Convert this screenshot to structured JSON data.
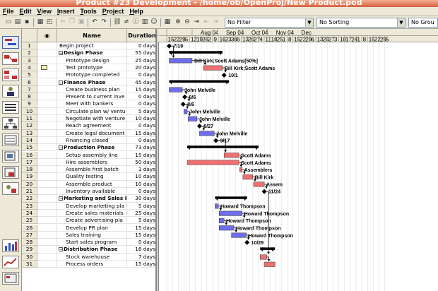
{
  "window": {
    "title": "Product #23 Development - /home/ob/OpenProj/New Product.pod"
  },
  "menu": [
    {
      "u": "F",
      "rest": "ile"
    },
    {
      "u": "E",
      "rest": "dit"
    },
    {
      "u": "V",
      "rest": "iew"
    },
    {
      "u": "I",
      "rest": "nsert"
    },
    {
      "u": "T",
      "rest": "ools"
    },
    {
      "u": "P",
      "rest": "roject"
    },
    {
      "u": "H",
      "rest": "elp"
    }
  ],
  "toolbar": {
    "filter": "No Filter",
    "sorting": "No Sorting",
    "grouping": "No Grou",
    "combo_arrow": "▼"
  },
  "grid": {
    "headers": {
      "info": "◉",
      "name": "Name",
      "duration": "Duration"
    },
    "expanded_marker": "−",
    "rows": [
      {
        "id": "1",
        "name": "Begin project",
        "dur": "0 days",
        "lvl": 1,
        "sum": false
      },
      {
        "id": "2",
        "name": "Design Phase",
        "dur": "55 days",
        "lvl": 0,
        "sum": true
      },
      {
        "id": "3",
        "name": "Prototype design",
        "dur": "25 days",
        "lvl": 2,
        "sum": false
      },
      {
        "id": "4",
        "name": "Test prototype",
        "dur": "20 days",
        "lvl": 2,
        "sum": false,
        "note": true
      },
      {
        "id": "5",
        "name": "Prototype completed",
        "dur": "0 days",
        "lvl": 2,
        "sum": false
      },
      {
        "id": "6",
        "name": "Finance Phase",
        "dur": "45 days",
        "lvl": 0,
        "sum": true
      },
      {
        "id": "7",
        "name": "Create business plan",
        "dur": "15 days",
        "lvl": 2,
        "sum": false
      },
      {
        "id": "8",
        "name": "Present to current inve",
        "dur": "0 days",
        "lvl": 2,
        "sum": false
      },
      {
        "id": "9",
        "name": "Meet with bankers",
        "dur": "0 days",
        "lvl": 2,
        "sum": false
      },
      {
        "id": "10",
        "name": "Circulate plan w/ ventu",
        "dur": "5 days",
        "lvl": 2,
        "sum": false
      },
      {
        "id": "11",
        "name": "Negotiate with venture",
        "dur": "10 days",
        "lvl": 2,
        "sum": false
      },
      {
        "id": "12",
        "name": "Reach agreement",
        "dur": "0 days",
        "lvl": 2,
        "sum": false
      },
      {
        "id": "13",
        "name": "Create legal document",
        "dur": "15 days",
        "lvl": 2,
        "sum": false
      },
      {
        "id": "14",
        "name": "Financing closed",
        "dur": "0 days",
        "lvl": 2,
        "sum": false
      },
      {
        "id": "15",
        "name": "Production Phase",
        "dur": "73 days",
        "lvl": 0,
        "sum": true
      },
      {
        "id": "16",
        "name": "Setup assembly line",
        "dur": "15 days",
        "lvl": 2,
        "sum": false
      },
      {
        "id": "17",
        "name": "Hire assemblers",
        "dur": "50 days",
        "lvl": 2,
        "sum": false
      },
      {
        "id": "18",
        "name": "Assemble first batch",
        "dur": "3 days",
        "lvl": 2,
        "sum": false
      },
      {
        "id": "19",
        "name": "Quality testing",
        "dur": "10 days",
        "lvl": 2,
        "sum": false
      },
      {
        "id": "20",
        "name": "Assemble product",
        "dur": "10 days",
        "lvl": 2,
        "sum": false
      },
      {
        "id": "21",
        "name": "Inventory available",
        "dur": "0 days",
        "lvl": 2,
        "sum": false
      },
      {
        "id": "22",
        "name": "Marketing and Sales P",
        "dur": "30 days",
        "lvl": 0,
        "sum": true
      },
      {
        "id": "23",
        "name": "Develop marketing pla",
        "dur": "5 days",
        "lvl": 2,
        "sum": false
      },
      {
        "id": "24",
        "name": "Create sales materials",
        "dur": "25 days",
        "lvl": 2,
        "sum": false
      },
      {
        "id": "25",
        "name": "Create advertising pla",
        "dur": "5 days",
        "lvl": 2,
        "sum": false
      },
      {
        "id": "26",
        "name": "Develop PR plan",
        "dur": "15 days",
        "lvl": 2,
        "sum": false
      },
      {
        "id": "27",
        "name": "Sales training",
        "dur": "15 days",
        "lvl": 2,
        "sum": false
      },
      {
        "id": "28",
        "name": "Start sales program",
        "dur": "0 days",
        "lvl": 2,
        "sum": false
      },
      {
        "id": "29",
        "name": "Distribution Phase",
        "dur": "16 days",
        "lvl": 0,
        "sum": true
      },
      {
        "id": "30",
        "name": "Stock warehouse",
        "dur": "7 days",
        "lvl": 2,
        "sum": false
      },
      {
        "id": "31",
        "name": "Process orders",
        "dur": "15 days",
        "lvl": 2,
        "sum": false
      }
    ]
  },
  "gantt": {
    "months": [
      "Aug 04",
      "Sep 04",
      "Oct 04",
      "Nov 04",
      "Dec"
    ],
    "days": [
      "15",
      "22",
      "29",
      "5",
      "12",
      "19",
      "26",
      "2",
      "9",
      "16",
      "23",
      "30",
      "6",
      "13",
      "20",
      "27",
      "4",
      "11",
      "18",
      "25",
      "1",
      "8",
      "15",
      "22",
      "29",
      "6",
      "13",
      "20",
      "27",
      "3",
      "10",
      "17",
      "24",
      "1",
      "8",
      "15",
      "22",
      "29",
      "5"
    ],
    "colors": {
      "summary": "#000000",
      "task": "#6e6eee",
      "critical": "#ee7070",
      "link": "#000000",
      "gridline": "#d8d8d8"
    },
    "bars": [
      {
        "row": 1,
        "type": "milestone",
        "day": 3,
        "label": "7/19"
      },
      {
        "row": 2,
        "type": "summary",
        "start": 3,
        "end": 68
      },
      {
        "row": 3,
        "type": "task",
        "start": 3,
        "end": 31,
        "label": "Bill Kirk;Scott Adams[50%]"
      },
      {
        "row": 4,
        "type": "critical",
        "start": 45,
        "end": 68,
        "label": "Bill Kirk;Scott Adams"
      },
      {
        "row": 5,
        "type": "milestone",
        "day": 70,
        "label": "10/1"
      },
      {
        "row": 6,
        "type": "summary",
        "start": 3,
        "end": 76
      },
      {
        "row": 7,
        "type": "task",
        "start": 3,
        "end": 19,
        "label": "John Melville"
      },
      {
        "row": 8,
        "type": "milestone",
        "day": 22,
        "label": "8/6"
      },
      {
        "row": 9,
        "type": "milestone",
        "day": 20,
        "label": "8/6"
      },
      {
        "row": 10,
        "type": "task",
        "start": 21,
        "end": 25,
        "label": "John Melville"
      },
      {
        "row": 11,
        "type": "task",
        "start": 26,
        "end": 37,
        "label": "John Melville"
      },
      {
        "row": 12,
        "type": "milestone",
        "day": 40,
        "label": "8/27"
      },
      {
        "row": 13,
        "type": "task",
        "start": 40,
        "end": 58,
        "label": "John Melville"
      },
      {
        "row": 14,
        "type": "milestone",
        "day": 60,
        "label": "9/17"
      },
      {
        "row": 15,
        "type": "summary",
        "start": 25,
        "end": 112
      },
      {
        "row": 16,
        "type": "critical",
        "start": 70,
        "end": 88,
        "label": "Scott Adams"
      },
      {
        "row": 17,
        "type": "critical",
        "start": 25,
        "end": 88,
        "label": "Scott Adams"
      },
      {
        "row": 18,
        "type": "critical",
        "start": 89,
        "end": 92,
        "label": "Assemblers"
      },
      {
        "row": 19,
        "type": "critical",
        "start": 93,
        "end": 105,
        "label": "Bill Kirk"
      },
      {
        "row": 20,
        "type": "critical",
        "start": 106,
        "end": 119,
        "label": "Assem"
      },
      {
        "row": 21,
        "type": "milestone",
        "day": 119,
        "label": "11/24"
      },
      {
        "row": 22,
        "type": "summary",
        "start": 59,
        "end": 98
      },
      {
        "row": 23,
        "type": "task",
        "start": 59,
        "end": 63,
        "label": "Howard Thompson"
      },
      {
        "row": 24,
        "type": "task",
        "start": 64,
        "end": 92,
        "label": "Howard Thompson"
      },
      {
        "row": 25,
        "type": "task",
        "start": 64,
        "end": 70,
        "label": "Howard Thompson"
      },
      {
        "row": 26,
        "type": "task",
        "start": 64,
        "end": 82,
        "label": "Howard Thompson"
      },
      {
        "row": 27,
        "type": "task",
        "start": 79,
        "end": 97,
        "label": "Howard Thompson"
      },
      {
        "row": 28,
        "type": "milestone",
        "day": 98,
        "label": "10/29"
      },
      {
        "row": 29,
        "type": "summary",
        "start": 114,
        "end": 132
      },
      {
        "row": 30,
        "type": "critical",
        "start": 114,
        "end": 122,
        "label": ""
      },
      {
        "row": 31,
        "type": "critical",
        "start": 119,
        "end": 132,
        "label": ""
      }
    ],
    "links": [
      [
        1,
        3
      ],
      [
        3,
        4
      ],
      [
        4,
        5
      ],
      [
        7,
        8
      ],
      [
        8,
        9
      ],
      [
        9,
        10
      ],
      [
        10,
        11
      ],
      [
        11,
        12
      ],
      [
        12,
        13
      ],
      [
        13,
        14
      ],
      [
        14,
        16
      ],
      [
        16,
        17
      ],
      [
        17,
        18
      ],
      [
        18,
        19
      ],
      [
        19,
        20
      ],
      [
        20,
        21
      ],
      [
        23,
        24
      ],
      [
        24,
        25
      ],
      [
        25,
        26
      ],
      [
        26,
        27
      ],
      [
        27,
        28
      ],
      [
        21,
        30
      ],
      [
        30,
        31
      ]
    ]
  }
}
